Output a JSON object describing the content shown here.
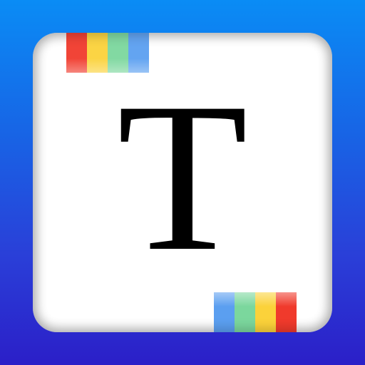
{
  "app_icon": {
    "glyph": "T",
    "background_gradient": [
      "#0a8cf5",
      "#2b1fc8"
    ],
    "card_color": "#ffffff",
    "glyph_color": "#000000",
    "top_strip_colors": [
      "#f03a2c",
      "#fbd23a",
      "#7bd79d",
      "#5b9ff0"
    ],
    "bottom_strip_colors": [
      "#5b9ff0",
      "#7bd79d",
      "#fbd23a",
      "#f03a2c"
    ]
  }
}
